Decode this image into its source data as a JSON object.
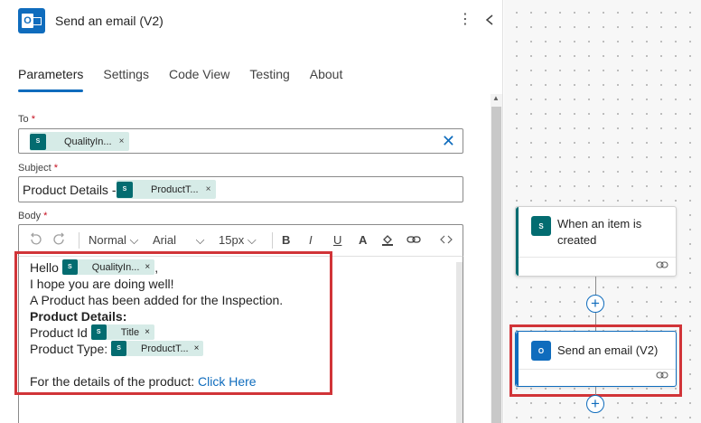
{
  "header": {
    "title": "Send an email (V2)",
    "more_icon": "more-vertical-icon",
    "collapse_icon": "chevron-left-icon"
  },
  "tabs": [
    {
      "label": "Parameters",
      "active": true
    },
    {
      "label": "Settings",
      "active": false
    },
    {
      "label": "Code View",
      "active": false
    },
    {
      "label": "Testing",
      "active": false
    },
    {
      "label": "About",
      "active": false
    }
  ],
  "fields": {
    "to": {
      "label": "To",
      "required_mark": "*",
      "token": "QualityIn...",
      "token_remove": "×",
      "clear": "✕"
    },
    "subject": {
      "label": "Subject",
      "required_mark": "*",
      "prefix": "Product Details - ",
      "token": "ProductT...",
      "token_remove": "×"
    },
    "body": {
      "label": "Body",
      "required_mark": "*"
    }
  },
  "toolbar": {
    "undo_icon": "undo-icon",
    "redo_icon": "redo-icon",
    "style": "Normal",
    "font": "Arial",
    "size": "15px",
    "bold": "B",
    "italic": "I",
    "underline": "U",
    "font_color": "A",
    "highlight_icon": "paint-bucket-icon",
    "link_icon": "link-icon",
    "code_icon": "code-view-icon"
  },
  "body": {
    "hello": "Hello",
    "hello_token": "QualityIn...",
    "hello_suffix": ",",
    "line2": "I hope you are doing well!",
    "line3": "A Product has been added for the Inspection.",
    "line4": "Product Details:",
    "line5_label": "Product Id",
    "line5_token": "Title",
    "line6_label": "Product Type:",
    "line6_token": "ProductT...",
    "line8_text": "For the details of the product: ",
    "line8_link": "Click Here",
    "token_remove": "×"
  },
  "canvas": {
    "trigger": {
      "title": "When an item is created",
      "icon": "sharepoint-icon",
      "link_icon": "link-icon"
    },
    "action": {
      "title": "Send an email (V2)",
      "icon": "outlook-icon",
      "link_icon": "link-icon"
    },
    "add_step": "+"
  },
  "colors": {
    "accent": "#0f6cbd",
    "sharepoint": "#036c70",
    "token_bg": "#d6ebe7",
    "highlight": "#d13438"
  }
}
